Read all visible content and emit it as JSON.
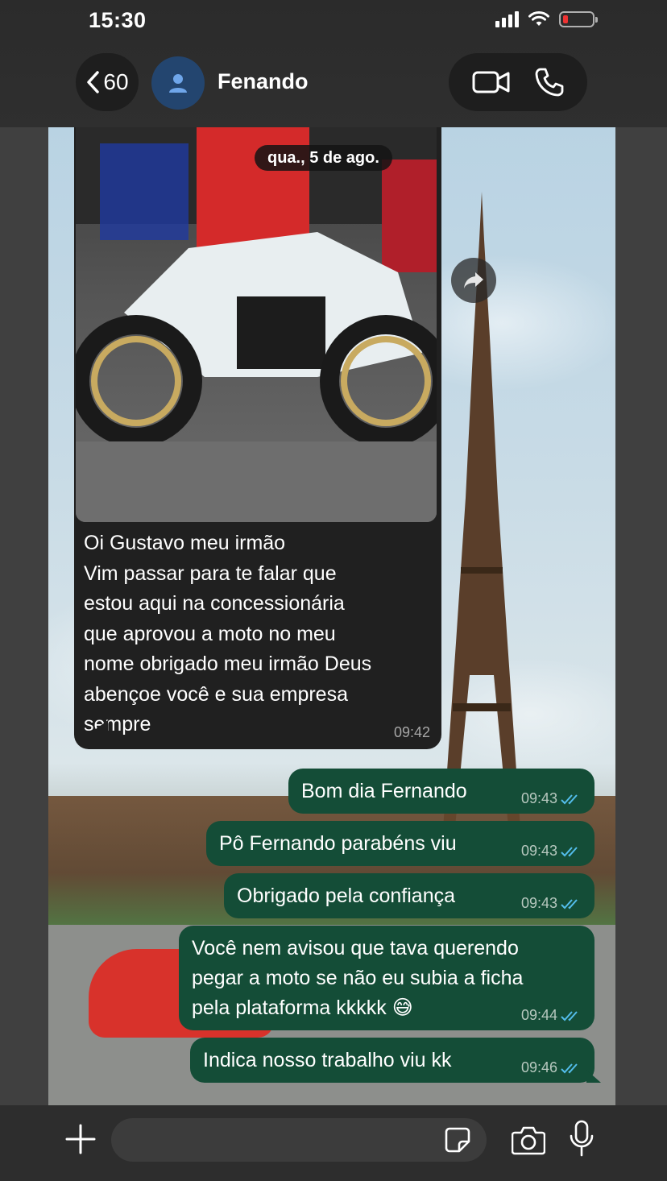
{
  "status_bar": {
    "time": "15:30"
  },
  "header": {
    "back_count": "60",
    "contact_name": "Fenando",
    "video_call_icon": "video-camera-icon",
    "voice_call_icon": "phone-icon"
  },
  "chat": {
    "date_chip": "qua., 5 de ago.",
    "incoming": {
      "has_photo": true,
      "text": "Oi Gustavo meu irmão\nVim passar para te falar que estou aqui na concessionária que aprovou a moto no meu nome obrigado meu irmão Deus abençoe você e sua empresa sempre",
      "time": "09:42"
    },
    "outgoing": [
      {
        "text": "Bom dia Fernando",
        "time": "09:43"
      },
      {
        "text": "Pô Fernando parabéns viu",
        "time": "09:43"
      },
      {
        "text": "Obrigado pela confiança",
        "time": "09:43"
      },
      {
        "text": "Você nem avisou que tava querendo\npegar a moto se não eu subia a ficha\npela plataforma kkkkk 😅",
        "time": "09:44"
      },
      {
        "text": "Indica nosso trabalho viu kk",
        "time": "09:46"
      }
    ]
  },
  "composer": {
    "placeholder": "",
    "icons": [
      "plus-icon",
      "sticker-icon",
      "camera-icon",
      "microphone-icon"
    ]
  },
  "colors": {
    "outgoing_bubble": "#144d37",
    "incoming_bubble": "#202020",
    "read_ticks": "#53bdeb"
  }
}
